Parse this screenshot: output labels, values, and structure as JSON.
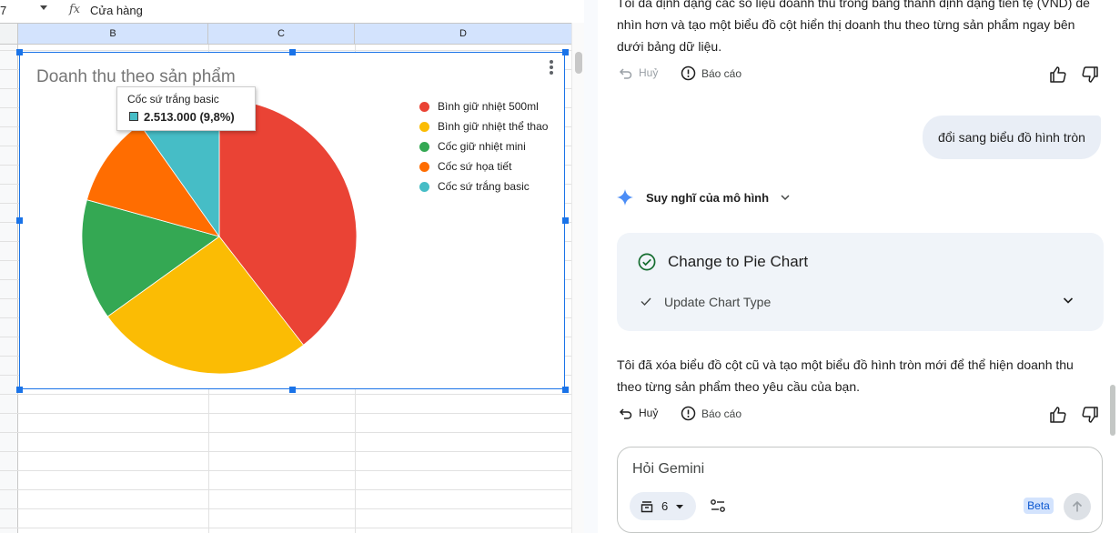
{
  "formula_bar": {
    "cell_ref": "7",
    "fx_label": "fx",
    "value": "Cửa hàng"
  },
  "columns": [
    "B",
    "C",
    "D"
  ],
  "chart_data": {
    "type": "pie",
    "title": "Doanh thu theo sản phẩm",
    "categories": [
      "Bình giữ nhiệt 500ml",
      "Bình giữ nhiệt thể thao",
      "Cốc giữ nhiệt mini",
      "Cốc sứ họa tiết",
      "Cốc sứ trắng basic"
    ],
    "values": [
      39.5,
      25.6,
      14.2,
      10.9,
      9.8
    ],
    "value_unit": "%",
    "colors": [
      "#ea4335",
      "#fbbc04",
      "#34a853",
      "#ff6d01",
      "#46bdc6"
    ],
    "legend_position": "right",
    "tooltip": {
      "name": "Cốc sứ trắng basic",
      "value": "2.513.000 (9,8%)"
    }
  },
  "panel": {
    "prev_message": [
      "Tôi đã định dạng các số liệu doanh thu trong bảng thành định dạng tiền tệ (VND) để",
      "nhìn hơn và tạo một biểu đồ cột hiển thị doanh thu theo từng sản phẩm ngay bên",
      "dưới bảng dữ liệu."
    ],
    "undo_label": "Huỷ",
    "report_label": "Báo cáo",
    "user_message": "đổi sang biểu đồ hình tròn",
    "thinking_label": "Suy nghĩ của mô hình",
    "card": {
      "title": "Change to Pie Chart",
      "step": "Update Chart Type"
    },
    "reply": [
      "Tôi đã xóa biểu đồ cột cũ và tạo một biểu đồ hình tròn mới để thể hiện doanh thu",
      "theo từng sản phẩm theo yêu cầu của bạn."
    ],
    "input_placeholder": "Hỏi Gemini",
    "model_count": "6",
    "beta_label": "Beta"
  }
}
